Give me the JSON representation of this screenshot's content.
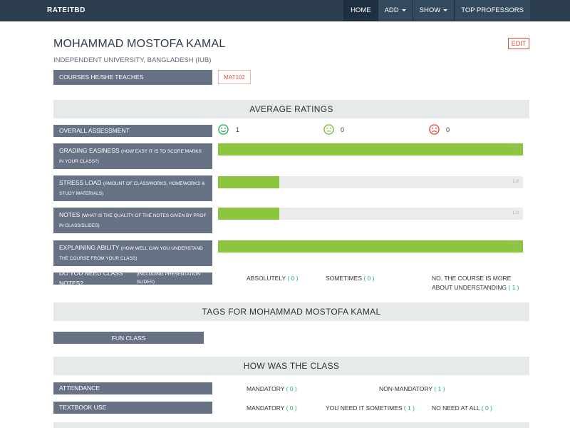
{
  "nav": {
    "brand": "RATEITBD",
    "items": [
      {
        "label": "HOME",
        "dropdown": false
      },
      {
        "label": "ADD",
        "dropdown": true
      },
      {
        "label": "SHOW",
        "dropdown": true
      },
      {
        "label": "TOP PROFESSORS",
        "dropdown": false
      }
    ]
  },
  "professor": {
    "name": "MOHAMMAD MOSTOFA KAMAL",
    "university": "INDEPENDENT UNIVERSITY, BANGLADESH (IUB)",
    "edit_label": "EDIT"
  },
  "courses": {
    "label": "COURSES HE/SHE TEACHES",
    "items": [
      "MAT102"
    ]
  },
  "ratings": {
    "heading": "AVERAGE RATINGS",
    "overall_label": "OVERALL ASSESSMENT",
    "overall": {
      "good": "1",
      "neutral": "0",
      "bad": "0"
    },
    "metrics": [
      {
        "label": "GRADING EASINESS",
        "sub": "(HOW EASY IT IS TO SCORE MARKS IN YOUR CLASS?)",
        "value": "5.0",
        "fraction": 1.0
      },
      {
        "label": "STRESS LOAD",
        "sub": "(AMOUNT OF CLASSWORKS, HOMEWORKS & STUDY MATERIALS)",
        "value": "1.0",
        "fraction": 0.2
      },
      {
        "label": "NOTES",
        "sub": "(WHAT IS THE QUALITY OF THE NOTES GIVEN BY PROF IN CLASS/SLIDES)",
        "value": "1.0",
        "fraction": 0.2
      },
      {
        "label": "EXPLAINING ABILITY",
        "sub": "(HOW WELL CAN YOU UNDERSTAND THE COURSE FROM YOUR CLASS)",
        "value": "5.0",
        "fraction": 1.0
      }
    ],
    "class_notes": {
      "label": "DO YOU NEED CLASS NOTES?",
      "sub": "(INCLUDING PRESENTATION SLIDES)",
      "options": [
        {
          "label": "ABSOLUTELY",
          "count": "( 0 )"
        },
        {
          "label": "SOMETIMES",
          "count": "( 0 )"
        },
        {
          "label": "NO, THE COURSE IS MORE ABOUT UNDERSTANDING",
          "count": "( 1 )"
        }
      ]
    }
  },
  "tags": {
    "heading": "TAGS FOR MOHAMMAD MOSTOFA KAMAL",
    "items": [
      "FUN CLASS"
    ]
  },
  "class_info": {
    "heading": "HOW WAS THE CLASS",
    "attendance": {
      "label": "ATTENDANCE",
      "options": [
        {
          "label": "MANDATORY",
          "count": "( 0 )"
        },
        {
          "label": "NON-MANDATORY",
          "count": "( 1 )"
        }
      ]
    },
    "textbook": {
      "label": "TEXTBOOK USE",
      "options": [
        {
          "label": "MANDATORY",
          "count": "( 0 )"
        },
        {
          "label": "YOU NEED IT SOMETIMES",
          "count": "( 1 )"
        },
        {
          "label": "NO NEED AT ALL",
          "count": "( 0 )"
        }
      ]
    }
  },
  "colors": {
    "navbar": "#2c3e50",
    "label_bg": "#677285",
    "bar_fill": "#8cc63e",
    "accent_red": "#e74c3c",
    "count_green": "#27ae60"
  }
}
